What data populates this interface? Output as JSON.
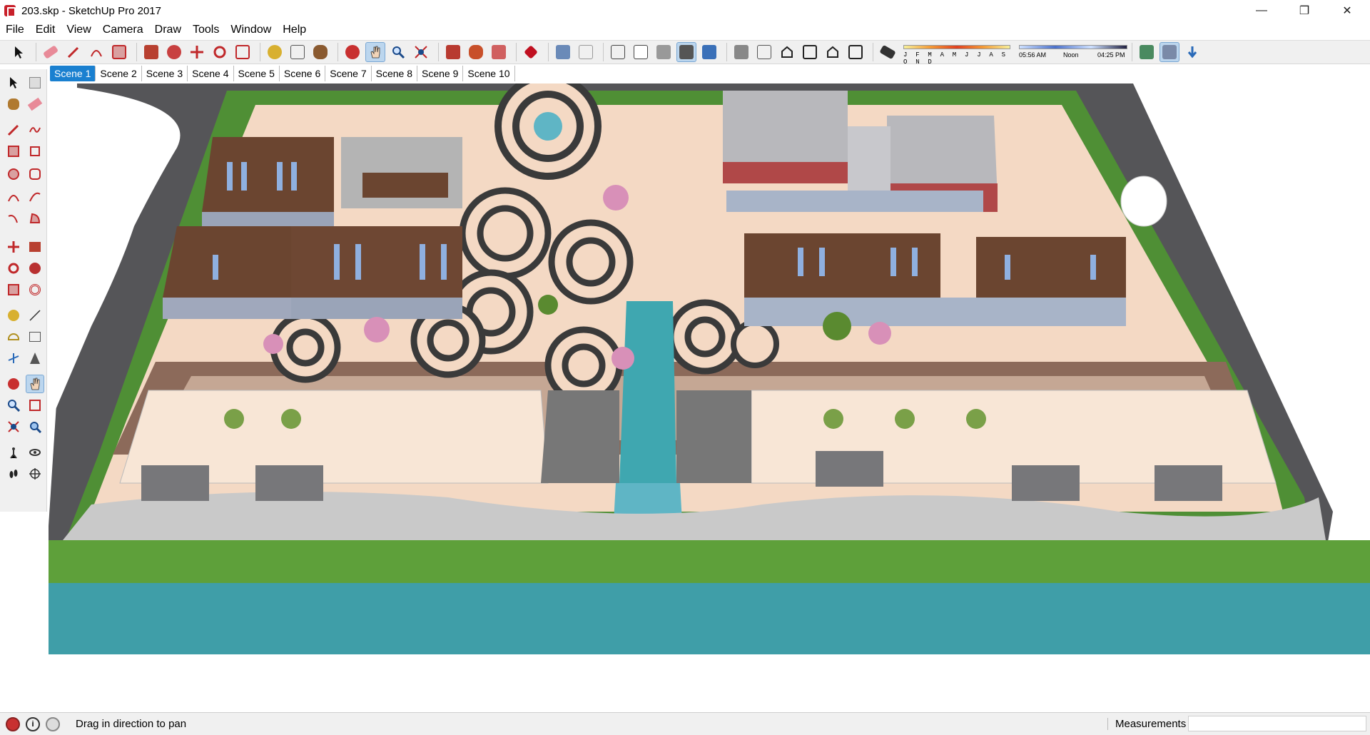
{
  "window": {
    "title": "203.skp - SketchUp Pro 2017",
    "controls": {
      "minimize": "—",
      "maximize": "❐",
      "close": "✕"
    }
  },
  "menu": [
    "File",
    "Edit",
    "View",
    "Camera",
    "Draw",
    "Tools",
    "Window",
    "Help"
  ],
  "toolbar": {
    "months": "J F M A M J J A S O N D",
    "time_start": "05:56 AM",
    "time_mid": "Noon",
    "time_end": "04:25 PM",
    "active_tool": "pan-icon"
  },
  "scenes": [
    "Scene 1",
    "Scene 2",
    "Scene 3",
    "Scene 4",
    "Scene 5",
    "Scene 6",
    "Scene 7",
    "Scene 8",
    "Scene 9",
    "Scene 10"
  ],
  "active_scene": "Scene 1",
  "status": {
    "message": "Drag in direction to pan",
    "measurements_label": "Measurements",
    "measurements_value": ""
  },
  "colors": {
    "accent": "#1a80d0",
    "roof_brown": "#6b4530",
    "road": "#555558",
    "plaza": "#f4d9c4",
    "grass": "#5ea03a",
    "water": "#3fa7b0"
  }
}
